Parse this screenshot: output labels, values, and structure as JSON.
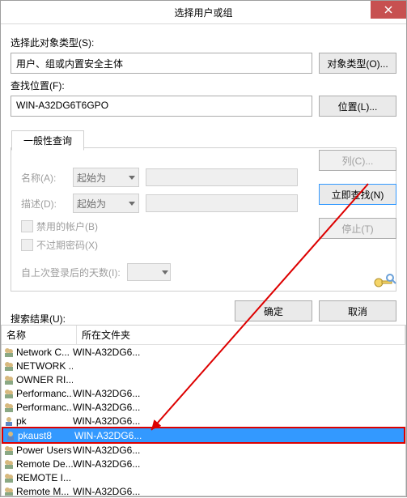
{
  "title": "选择用户或组",
  "labels": {
    "object_type": "选择此对象类型(S):",
    "location": "查找位置(F):",
    "tab_common": "一般性查询",
    "name": "名称(A):",
    "desc": "描述(D):",
    "starts_with": "起始为",
    "disabled_accounts": "禁用的帐户(B)",
    "non_expiring_pw": "不过期密码(X)",
    "days_since_logon": "自上次登录后的天数(I):",
    "search_results": "搜索结果(U):",
    "col_name": "名称",
    "col_folder": "所在文件夹"
  },
  "values": {
    "object_type": "用户、组或内置安全主体",
    "location": "WIN-A32DG6T6GPO"
  },
  "buttons": {
    "object_types": "对象类型(O)...",
    "locations": "位置(L)...",
    "columns": "列(C)...",
    "find_now": "立即查找(N)",
    "stop": "停止(T)",
    "ok": "确定",
    "cancel": "取消"
  },
  "results": [
    {
      "icon": "group",
      "name": "Network C...",
      "folder": "WIN-A32DG6..."
    },
    {
      "icon": "group",
      "name": "NETWORK ...",
      "folder": ""
    },
    {
      "icon": "group",
      "name": "OWNER RI...",
      "folder": ""
    },
    {
      "icon": "group",
      "name": "Performanc...",
      "folder": "WIN-A32DG6..."
    },
    {
      "icon": "group",
      "name": "Performanc...",
      "folder": "WIN-A32DG6..."
    },
    {
      "icon": "user",
      "name": "pk",
      "folder": "WIN-A32DG6..."
    },
    {
      "icon": "user",
      "name": "pkaust8",
      "folder": "WIN-A32DG6...",
      "selected": true
    },
    {
      "icon": "group",
      "name": "Power Users",
      "folder": "WIN-A32DG6..."
    },
    {
      "icon": "group",
      "name": "Remote De...",
      "folder": "WIN-A32DG6..."
    },
    {
      "icon": "group",
      "name": "REMOTE I...",
      "folder": ""
    },
    {
      "icon": "group",
      "name": "Remote M...",
      "folder": "WIN-A32DG6..."
    }
  ]
}
